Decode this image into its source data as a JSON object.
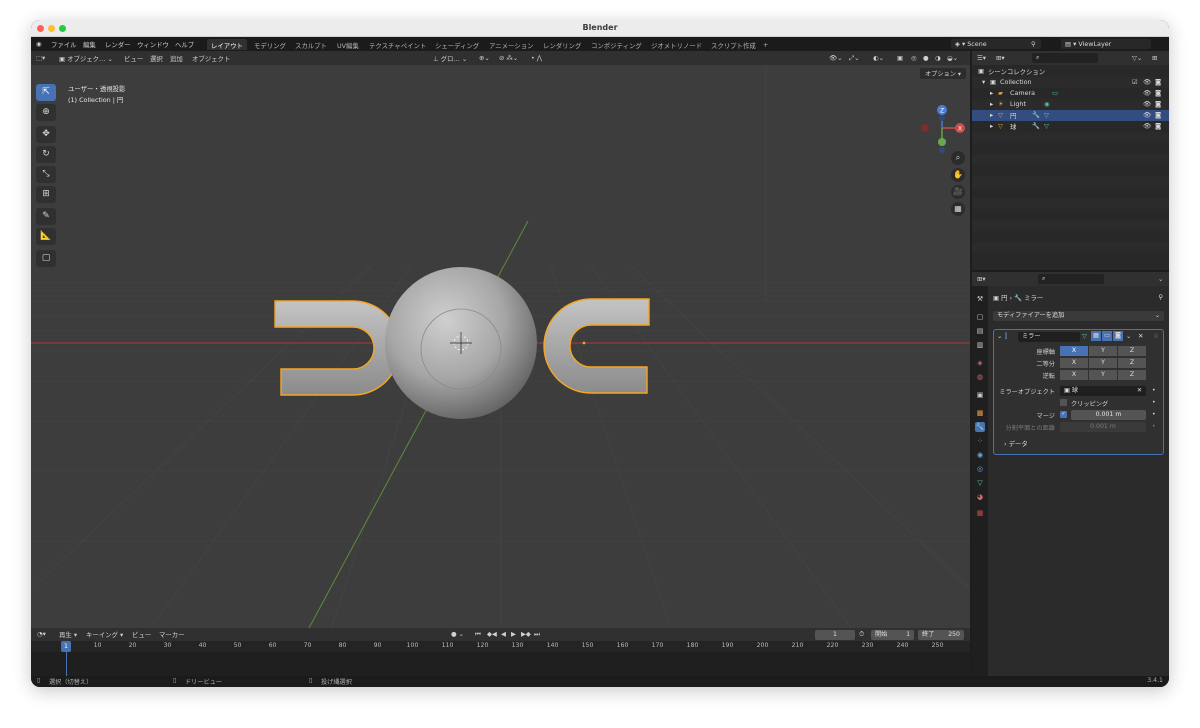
{
  "window": {
    "title": "Blender"
  },
  "topbar": {
    "menus": [
      "ファイル",
      "編集",
      "レンダー",
      "ウィンドウ",
      "ヘルプ"
    ],
    "workspaces": [
      "レイアウト",
      "モデリング",
      "スカルプト",
      "UV編集",
      "テクスチャペイント",
      "シェーディング",
      "アニメーション",
      "レンダリング",
      "コンポジティング",
      "ジオメトリノード",
      "スクリプト作成"
    ],
    "add_tab": "+",
    "scene": "Scene",
    "view_layer": "ViewLayer"
  },
  "viewport": {
    "mode": "オブジェク…",
    "menus": [
      "ビュー",
      "選択",
      "追加",
      "オブジェクト"
    ],
    "transform_orientation": "グロ…",
    "options_label": "オプション ▾",
    "info_line1": "ユーザー・透視投影",
    "info_line2": "(1) Collection | 円",
    "gizmo": {
      "z": "Z",
      "x": "X",
      "y": "Y"
    }
  },
  "outliner": {
    "root": "シーンコレクション",
    "collection": "Collection",
    "items": [
      {
        "name": "Camera",
        "icon": "camera-icon"
      },
      {
        "name": "Light",
        "icon": "light-icon"
      },
      {
        "name": "円",
        "icon": "mesh-icon",
        "selected": true
      },
      {
        "name": "球",
        "icon": "mesh-icon"
      }
    ]
  },
  "properties": {
    "breadcrumb_object": "円",
    "breadcrumb_modifier": "ミラー",
    "add_modifier": "モディファイアーを追加",
    "modifier_name": "ミラー",
    "rows": {
      "axis": "座標軸",
      "bisect": "二等分",
      "flip": "逆転",
      "x": "X",
      "y": "Y",
      "z": "Z"
    },
    "mirror_object_label": "ミラーオブジェクト",
    "mirror_object_value": "球",
    "clipping_label": "クリッピング",
    "merge_label": "マージ",
    "merge_value": "0.001 m",
    "bisect_distance_label": "分割平面との距離",
    "bisect_distance_value": "0.001 m",
    "data_label": "データ"
  },
  "timeline": {
    "menus": [
      "再生 ▾",
      "キーイング ▾",
      "ビュー",
      "マーカー"
    ],
    "current_frame": "1",
    "start_label": "開始",
    "start_value": "1",
    "end_label": "終了",
    "end_value": "250",
    "ticks": [
      "10",
      "20",
      "30",
      "40",
      "50",
      "60",
      "70",
      "80",
      "90",
      "100",
      "110",
      "120",
      "130",
      "140",
      "150",
      "160",
      "170",
      "180",
      "190",
      "200",
      "210",
      "220",
      "230",
      "240",
      "250"
    ]
  },
  "statusbar": {
    "left": "選択（切替え）",
    "middle": "ドリービュー",
    "right": "投げ縄選択",
    "version": "3.4.1"
  },
  "colors": {
    "selection_outline": "#f5a623",
    "accent_blue": "#4772b3",
    "x_axis": "#c94c4c",
    "y_axis": "#6aa84f",
    "z_axis": "#4a7fd4"
  }
}
